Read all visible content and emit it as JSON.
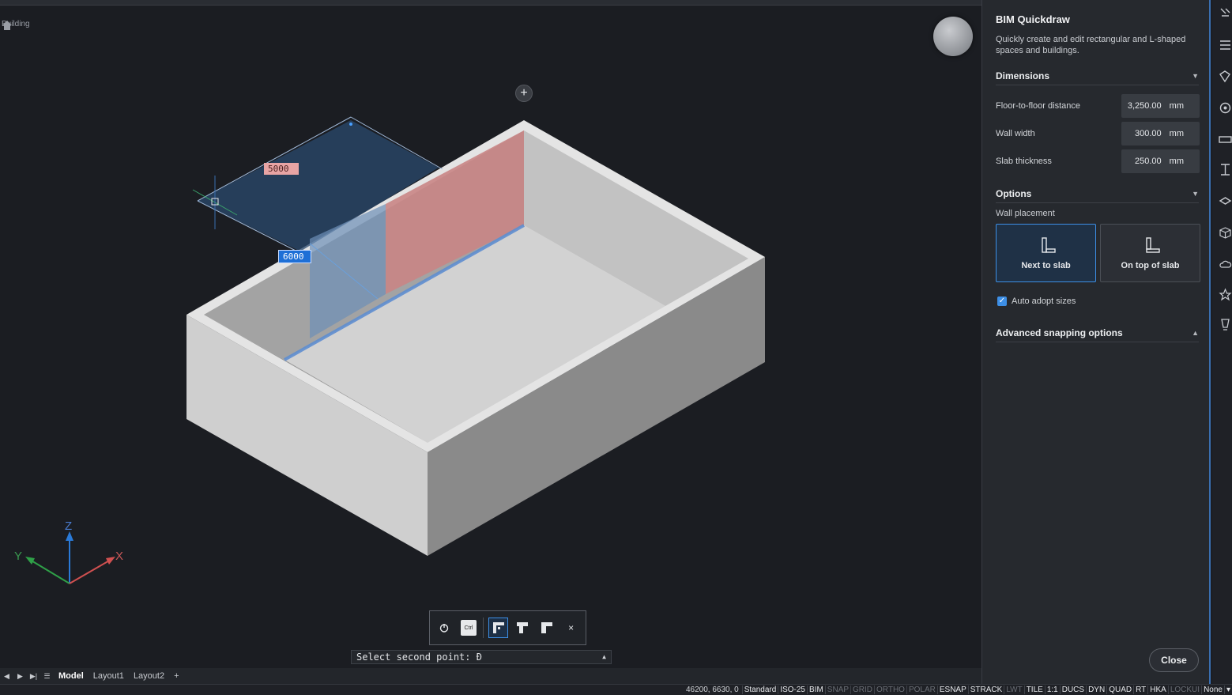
{
  "breadcrumb": {
    "label": "Building"
  },
  "viewport": {
    "dim_red": "5000",
    "dim_blue": "6000",
    "axes": {
      "x": "X",
      "y": "Y",
      "z": "Z"
    }
  },
  "quick_toolbar": {
    "ctrl_label": "Ctrl",
    "close_glyph": "×"
  },
  "command_line": {
    "text": "Select second point: Ð",
    "toggle": "▲"
  },
  "layout_tabs": {
    "items": [
      "Model",
      "Layout1",
      "Layout2"
    ],
    "add": "+"
  },
  "status_bar": {
    "coords": "46200, 6630, 0",
    "items": [
      {
        "label": "Standard",
        "on": true
      },
      {
        "label": "ISO-25",
        "on": true
      },
      {
        "label": "BIM",
        "on": true
      },
      {
        "label": "SNAP",
        "on": false
      },
      {
        "label": "GRID",
        "on": false
      },
      {
        "label": "ORTHO",
        "on": false
      },
      {
        "label": "POLAR",
        "on": false
      },
      {
        "label": "ESNAP",
        "on": true
      },
      {
        "label": "STRACK",
        "on": true
      },
      {
        "label": "LWT",
        "on": false
      },
      {
        "label": "TILE",
        "on": true
      },
      {
        "label": "1:1",
        "on": true
      },
      {
        "label": "DUCS",
        "on": true
      },
      {
        "label": "DYN",
        "on": true
      },
      {
        "label": "QUAD",
        "on": true
      },
      {
        "label": "RT",
        "on": true
      },
      {
        "label": "HKA",
        "on": true
      },
      {
        "label": "LOCKUI",
        "on": false
      },
      {
        "label": "None",
        "on": true
      }
    ]
  },
  "panel": {
    "title": "BIM Quickdraw",
    "description": "Quickly create and edit rectangular and L-shaped spaces and buildings.",
    "dimensions": {
      "heading": "Dimensions",
      "fields": [
        {
          "label": "Floor-to-floor distance",
          "value": "3,250.00",
          "unit": "mm"
        },
        {
          "label": "Wall width",
          "value": "300.00",
          "unit": "mm"
        },
        {
          "label": "Slab thickness",
          "value": "250.00",
          "unit": "mm"
        }
      ]
    },
    "options": {
      "heading": "Options",
      "wall_placement_label": "Wall placement",
      "next_to_slab": "Next to slab",
      "on_top_of_slab": "On top of slab",
      "auto_adopt": "Auto adopt sizes"
    },
    "advanced": {
      "heading": "Advanced snapping options"
    },
    "close_label": "Close"
  },
  "colors": {
    "accent": "#3d8fe6",
    "panel_bg": "#26292e",
    "viewport_bg": "#1b1d22"
  }
}
